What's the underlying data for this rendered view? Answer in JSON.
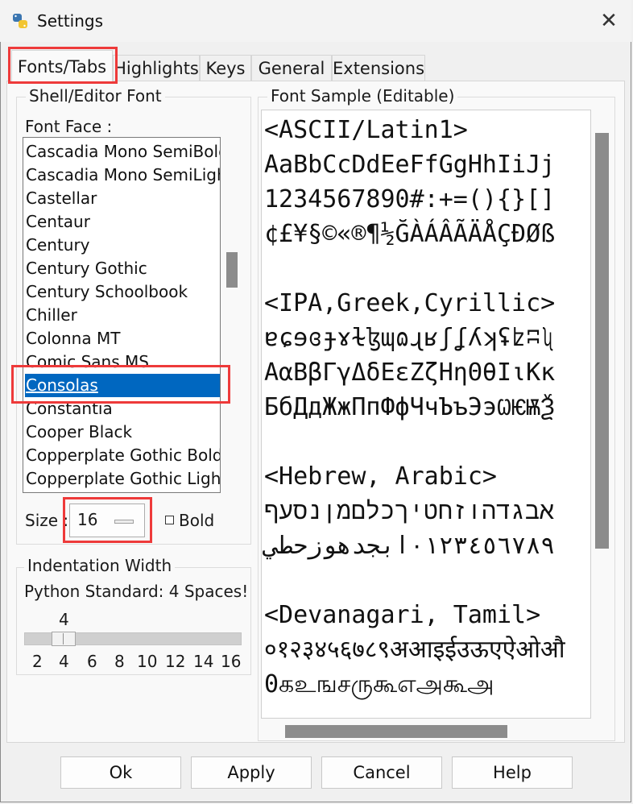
{
  "window": {
    "title": "Settings",
    "close_glyph": "✕"
  },
  "tabs": [
    {
      "label": "Fonts/Tabs",
      "active": true
    },
    {
      "label": "Highlights"
    },
    {
      "label": "Keys"
    },
    {
      "label": "General"
    },
    {
      "label": "Extensions"
    }
  ],
  "font_group": {
    "legend": "Shell/Editor Font",
    "face_label": "Font Face :",
    "fonts": [
      "Cascadia Mono SemiBold",
      "Cascadia Mono SemiLight",
      "Castellar",
      "Centaur",
      "Century",
      "Century Gothic",
      "Century Schoolbook",
      "Chiller",
      "Colonna MT",
      "Comic Sans MS",
      "Consolas",
      "Constantia",
      "Cooper Black",
      "Copperplate Gothic Bold",
      "Copperplate Gothic Light"
    ],
    "selected_font": "Consolas",
    "size_label": "Size :",
    "size_value": "16",
    "bold_label": "Bold",
    "bold_checked": false
  },
  "indent_group": {
    "legend": "Indentation Width",
    "note": "Python Standard: 4 Spaces!",
    "value": "4",
    "ticks": [
      "2",
      "4",
      "6",
      "8",
      "10",
      "12",
      "14",
      "16"
    ]
  },
  "sample_group": {
    "legend": "Font Sample (Editable)",
    "lines": [
      "<ASCII/Latin1>",
      "AaBbCcDdEeFfGgHhIiJj",
      "1234567890#:+=(){}[]",
      "¢£¥§©«®¶½ĞÀÁÂÃÄÅÇÐØß",
      "",
      "<IPA,Greek,Cyrillic>",
      "ɐɕɘɞɟɤɫɮɰɷɻʁʃʆʎʞʢʫʭʯ",
      "ΑαΒβΓγΔδΕεΖζΗηΘθΙιΚκ",
      "БбДдЖжПпФфЧчЪъЭэѠѤѬѮ",
      "",
      "<Hebrew, Arabic>",
      "אבגדהוזחטיךכלםמןנסעף",
      "٠١٢٣٤٥٦٧٨٩ابجدهوزحطي",
      "",
      "<Devanagari, Tamil>",
      "०१२३४५६७८९अआइईउऊएऐओऔ",
      "0கஉஙசருகூஎஅகூஅ"
    ]
  },
  "buttons": {
    "ok": "Ok",
    "apply": "Apply",
    "cancel": "Cancel",
    "help": "Help"
  },
  "colors": {
    "selection": "#0067c0",
    "highlight_box": "#ee3a3a"
  }
}
